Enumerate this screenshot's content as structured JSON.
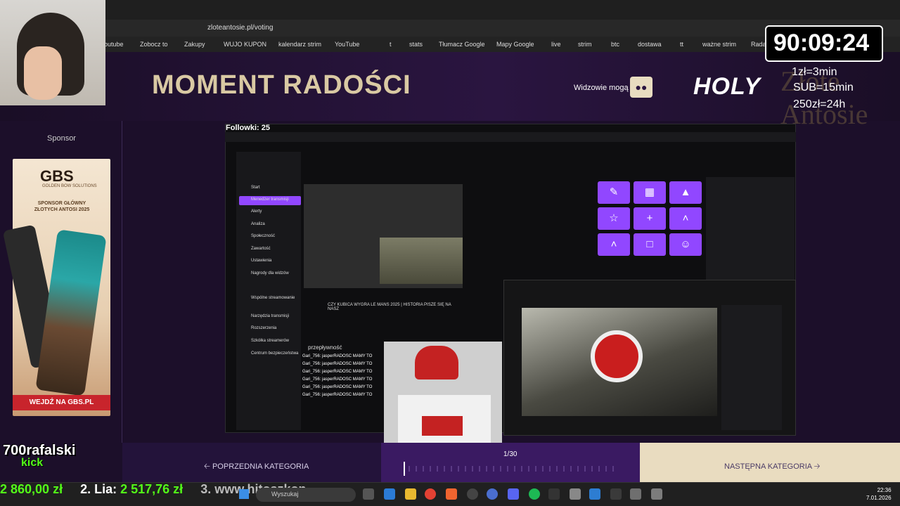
{
  "browser": {
    "url": "zloteantosie.pl/voting",
    "bookmarks": [
      "outube",
      "Zobocz to",
      "Zakupy",
      "WUJO KUPON",
      "kalendarz strim",
      "YouTube",
      "t",
      "stats",
      "Tłumacz Google",
      "Mapy Google",
      "live",
      "strim",
      "btc",
      "dostawa",
      "tt",
      "ważne strim",
      "Rada"
    ]
  },
  "header": {
    "title": "MOMENT RADOŚCI",
    "viewers_label": "Widzowie mogą",
    "holy_logo": "HOLY"
  },
  "sponsor": {
    "label": "Sponsor",
    "ad_brand": "GBS",
    "ad_brand_sub": "GOLDEN BOW SOLUTIONS",
    "ad_sponsor_text": "SPONSOR GŁÓWNY ZŁOTYCH ANTOSI 2025",
    "ad_cta": "WEJDŹ NA GBS.PL"
  },
  "stream": {
    "follow_counter": "Followki: 25",
    "sidebar_items": [
      "Start",
      "Menedżer transmisji",
      "Alerty",
      "Analiza",
      "Społeczność",
      "Zawartość",
      "Ustawienia",
      "Nagrody dla widzów",
      "Wspólne streamowanie",
      "Narzędzia transmisji",
      "Rozszerzenia",
      "Szkółka streamerów",
      "Centrum bezpieczeństwa"
    ],
    "chat_lines": [
      "Gari_756: jasperRADOSC MAMY TO",
      "Gari_756: jasperRADOSC MAMY TO",
      "Gari_756: jasperRADOSC MAMY TO",
      "Gari_756: jasperRADOSC MAMY TO",
      "Gari_756: jasperRADOSC MAMY TO",
      "Gari_756: jasperRADOSC MAMY TO"
    ],
    "chat_header": "przepływność",
    "stream_title": "CZY KUBICA WYGRA LE MANS 2025 | HISTORIA PISZE SIĘ NA NASZ"
  },
  "timer": {
    "time": "90:09:24",
    "line1": "1zł=3min",
    "line2": "SUB=15min",
    "line3": "250zł=24h"
  },
  "nav": {
    "prev_label": "POPRZEDNIA KATEGORIA",
    "next_label": "NASTĘPNA KATEGORIA",
    "page_counter": "1/30"
  },
  "overlay": {
    "kick_name": "700rafalski",
    "kick_tag": "kick",
    "ticker": [
      {
        "text": "2 860,00 zł",
        "color": "#53fc18"
      },
      {
        "text": "2. Lia: ",
        "color": "#ffffff"
      },
      {
        "text": "2 517,76 zł",
        "color": "#53fc18"
      },
      {
        "text": "3. www.hitoszkon",
        "color": "#bbbbbb"
      }
    ]
  },
  "taskbar": {
    "search_placeholder": "Wyszukaj",
    "time": "22:36",
    "date": "7.01.2026"
  }
}
